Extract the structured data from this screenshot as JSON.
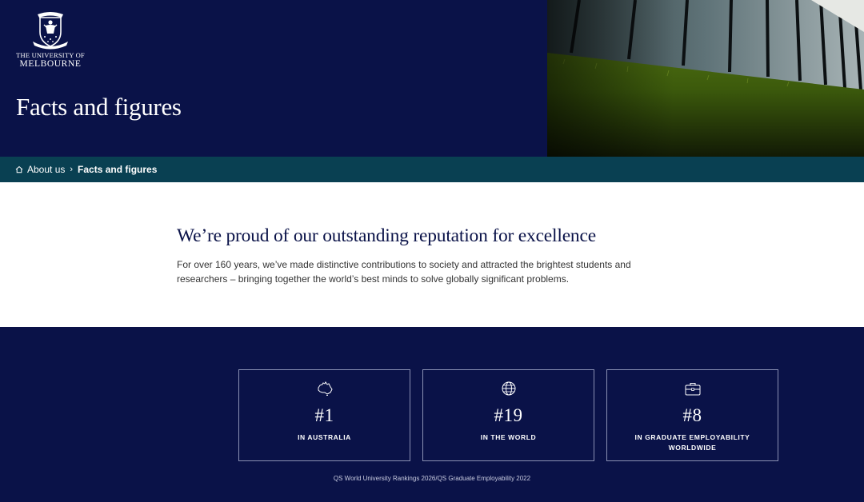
{
  "header": {
    "logo": {
      "line1": "THE UNIVERSITY OF",
      "line2": "MELBOURNE"
    },
    "title": "Facts and figures"
  },
  "breadcrumb": {
    "home_icon": "home-icon",
    "items": [
      {
        "label": "About us"
      },
      {
        "label": "Facts and figures"
      }
    ],
    "separator": "›"
  },
  "intro": {
    "heading": "We’re proud of our outstanding reputation for excellence",
    "body": "For over 160 years, we’ve made distinctive contributions to society and attracted the brightest students and researchers – bringing together the world’s best minds to solve globally significant problems."
  },
  "stats": {
    "items": [
      {
        "icon": "australia-map-icon",
        "rank": "#1",
        "label": "IN AUSTRALIA"
      },
      {
        "icon": "globe-icon",
        "rank": "#19",
        "label": "IN THE WORLD"
      },
      {
        "icon": "briefcase-icon",
        "rank": "#8",
        "label": "IN GRADUATE EMPLOYABILITY WORLDWIDE"
      }
    ],
    "source": "QS World University Rankings 2026/QS Graduate Employability 2022"
  },
  "colors": {
    "navy": "#0a1248",
    "teal": "#094052",
    "card_border": "#8a90b3"
  }
}
